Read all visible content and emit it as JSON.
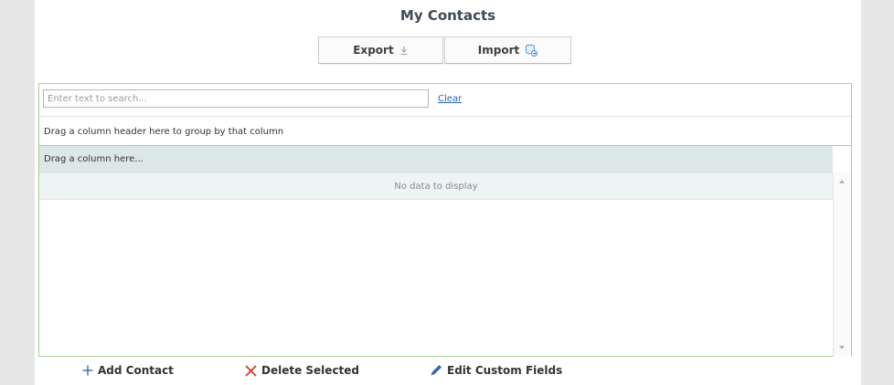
{
  "page": {
    "title": "My Contacts"
  },
  "toolbar": {
    "export_label": "Export",
    "import_label": "Import"
  },
  "search": {
    "placeholder": "Enter text to search...",
    "value": "",
    "clear_label": "Clear"
  },
  "grid": {
    "group_panel_text": "Drag a column header here to group by that column",
    "column_header_text": "Drag a column here...",
    "empty_text": "No data to display"
  },
  "actions": {
    "add_label": "Add Contact",
    "delete_label": "Delete Selected",
    "edit_label": "Edit Custom Fields"
  },
  "icons": {
    "export": "download-arrow-icon",
    "import": "import-database-icon",
    "add": "plus-icon",
    "delete": "x-icon",
    "edit": "pencil-icon"
  },
  "colors": {
    "grid_border": "#a9d08e",
    "header_bg": "#dce7e8",
    "delete_red": "#d9381e",
    "add_blue": "#2e5f9e",
    "link_blue": "#2a62b0"
  }
}
